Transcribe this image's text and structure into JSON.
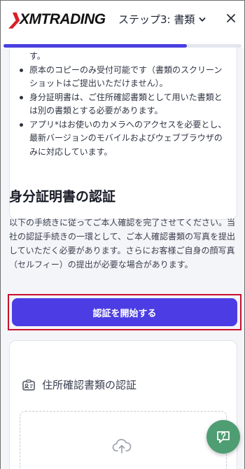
{
  "header": {
    "logo_text": "XMTRADING",
    "step_title": "ステップ3: 書類",
    "close_label": "×"
  },
  "progress": {
    "value": 0.77,
    "color": "#4a3fe0"
  },
  "requirements": {
    "partial_line": "す。",
    "items": [
      "原本のコピーのみ受付可能です（書類のスクリーンショットはご提出いただけません）。",
      "身分証明書は、ご住所確認書類として用いた書類とは別の書類とする必要があります。",
      "アプリ*はお使いのカメラへのアクセスを必要とし、最新バージョンのモバイルおよびウェブブラウザのみに対応しています。"
    ]
  },
  "identity_section": {
    "title": "身分証明書の認証",
    "description": "以下の手続きに従ってご本人確認を完了させてください。当社の認証手続きの一環として、ご本人確認書類の写真を提出していただく必要があります。さらにお客様ご自身の顔写真（セルフィー）の提出が必要な場合があります。",
    "start_button": "認証を開始する"
  },
  "address_section": {
    "title": "住所確認書類の認証",
    "icon": "id-card-icon",
    "upload_icon": "cloud-upload-icon"
  },
  "help": {
    "icon": "question-icon",
    "color": "#4f9d73"
  },
  "colors": {
    "accent": "#4b3de3",
    "highlight_border": "#c8102e",
    "logo_red": "#d91f26"
  }
}
